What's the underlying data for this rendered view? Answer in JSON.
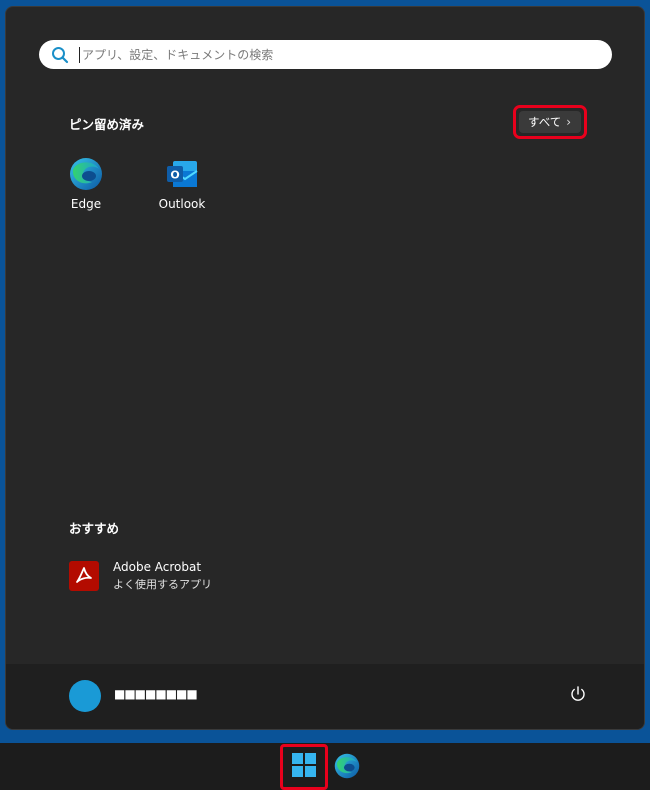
{
  "search": {
    "placeholder": "アプリ、設定、ドキュメントの検索"
  },
  "pinned": {
    "title": "ピン留め済み",
    "all_button": "すべて",
    "apps": [
      {
        "label": "Edge",
        "icon": "edge-icon"
      },
      {
        "label": "Outlook",
        "icon": "outlook-icon"
      }
    ]
  },
  "recommended": {
    "title": "おすすめ",
    "items": [
      {
        "name": "Adobe Acrobat",
        "subtitle": "よく使用するアプリ",
        "icon": "acrobat-icon"
      }
    ]
  },
  "user": {
    "name": "■■■■■■■■"
  },
  "colors": {
    "desktop": "#0a5398",
    "menu_bg": "#272727",
    "footer_bg": "#1f1f1f",
    "avatar": "#1a9ad6",
    "highlight": "#e8001c",
    "acrobat": "#b30b00"
  }
}
